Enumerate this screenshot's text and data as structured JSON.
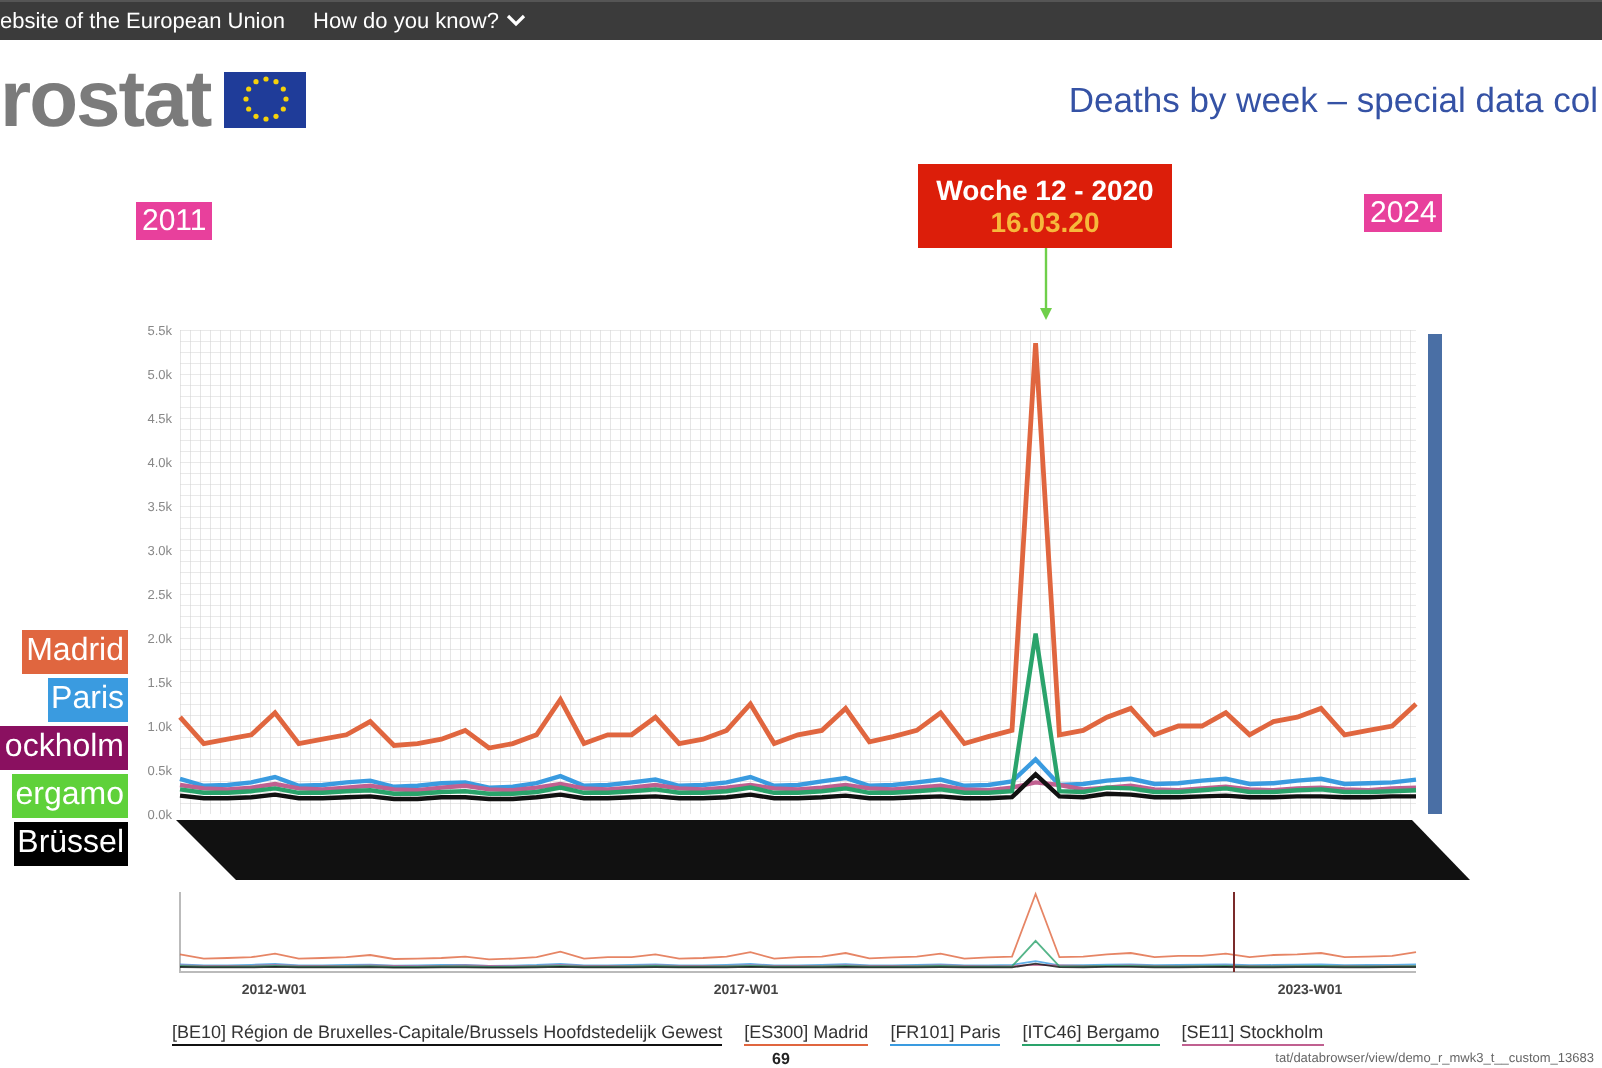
{
  "top_bar": {
    "site_text": "ebsite of the European Union",
    "menu_label": "How do you know?"
  },
  "header": {
    "logo_text": "rostat",
    "title": "Deaths by week – special data col"
  },
  "year_tags": [
    {
      "label": "2011",
      "kind": "start"
    },
    {
      "label": "2024",
      "kind": "end"
    }
  ],
  "callout": {
    "title": "Woche 12 - 2020",
    "date": "16.03.20"
  },
  "side_labels": [
    {
      "label": "Madrid",
      "color": "#e0663f"
    },
    {
      "label": "Paris",
      "color": "#3a9be0"
    },
    {
      "label": "ockholm",
      "color": "#8a1060"
    },
    {
      "label": "ergamo",
      "color": "#5fd13a"
    },
    {
      "label": "Brüssel",
      "color": "#000000"
    }
  ],
  "chart": {
    "chart_data": {
      "type": "line",
      "ylim": [
        0,
        5500
      ],
      "yticks": [
        {
          "value": 0,
          "label": "0.0k"
        },
        {
          "value": 500,
          "label": "0.5k"
        },
        {
          "value": 1000,
          "label": "1.0k"
        },
        {
          "value": 1500,
          "label": "1.5k"
        },
        {
          "value": 2000,
          "label": "2.0k"
        },
        {
          "value": 2500,
          "label": "2.5k"
        },
        {
          "value": 3000,
          "label": "3.0k"
        },
        {
          "value": 3500,
          "label": "3.5k"
        },
        {
          "value": 4000,
          "label": "4.0k"
        },
        {
          "value": 4500,
          "label": "4.5k"
        },
        {
          "value": 5000,
          "label": "5.0k"
        },
        {
          "value": 5500,
          "label": "5.5k"
        }
      ],
      "series": [
        {
          "name": "[ES300] Madrid",
          "color": "#e0663f",
          "values": [
            1100,
            800,
            850,
            900,
            1150,
            800,
            850,
            900,
            1050,
            780,
            800,
            850,
            950,
            750,
            800,
            900,
            1300,
            800,
            900,
            900,
            1100,
            800,
            850,
            950,
            1250,
            800,
            900,
            950,
            1200,
            820,
            880,
            950,
            1150,
            800,
            880,
            950,
            5350,
            900,
            950,
            1100,
            1200,
            900,
            1000,
            1000,
            1150,
            900,
            1050,
            1100,
            1200,
            900,
            950,
            1000,
            1250
          ]
        },
        {
          "name": "[FR101] Paris",
          "color": "#3a9be0",
          "values": [
            400,
            320,
            330,
            360,
            420,
            320,
            330,
            360,
            380,
            310,
            320,
            350,
            360,
            300,
            310,
            350,
            430,
            320,
            330,
            360,
            390,
            320,
            330,
            360,
            420,
            320,
            330,
            370,
            410,
            320,
            330,
            360,
            390,
            320,
            330,
            370,
            620,
            330,
            340,
            380,
            400,
            340,
            350,
            380,
            400,
            340,
            350,
            380,
            400,
            340,
            350,
            360,
            390
          ]
        },
        {
          "name": "[SE11] Stockholm",
          "color": "#c06090",
          "values": [
            330,
            290,
            280,
            300,
            340,
            290,
            280,
            300,
            320,
            280,
            270,
            300,
            320,
            280,
            270,
            300,
            340,
            290,
            280,
            300,
            330,
            290,
            280,
            300,
            330,
            290,
            280,
            300,
            330,
            290,
            280,
            300,
            320,
            280,
            270,
            300,
            360,
            330,
            280,
            300,
            320,
            280,
            270,
            290,
            310,
            280,
            270,
            290,
            300,
            280,
            270,
            290,
            300
          ]
        },
        {
          "name": "[ITC46] Bergamo",
          "color": "#2aa36b",
          "values": [
            280,
            240,
            240,
            260,
            290,
            240,
            240,
            260,
            270,
            230,
            230,
            250,
            260,
            230,
            230,
            250,
            300,
            240,
            240,
            260,
            280,
            240,
            240,
            260,
            300,
            240,
            240,
            260,
            290,
            240,
            240,
            260,
            280,
            240,
            240,
            260,
            2050,
            260,
            250,
            300,
            290,
            250,
            250,
            270,
            290,
            250,
            250,
            270,
            280,
            250,
            250,
            260,
            270
          ]
        },
        {
          "name": "[BE10] Région de Bruxelles-Capitale/Brussels Hoofdstedelijk Gewest",
          "color": "#111111",
          "values": [
            210,
            180,
            180,
            190,
            220,
            180,
            180,
            190,
            200,
            170,
            170,
            190,
            190,
            170,
            170,
            190,
            220,
            180,
            180,
            190,
            200,
            180,
            180,
            190,
            220,
            180,
            180,
            190,
            210,
            180,
            180,
            190,
            200,
            180,
            180,
            190,
            450,
            200,
            190,
            230,
            220,
            190,
            190,
            200,
            210,
            190,
            190,
            200,
            200,
            190,
            190,
            200,
            200
          ]
        }
      ]
    }
  },
  "navigator": {
    "x_labels": [
      "2012-W01",
      "2017-W01",
      "2023-W01"
    ]
  },
  "page_number": "69",
  "url_fragment": "tat/databrowser/view/demo_r_mwk3_t__custom_13683"
}
